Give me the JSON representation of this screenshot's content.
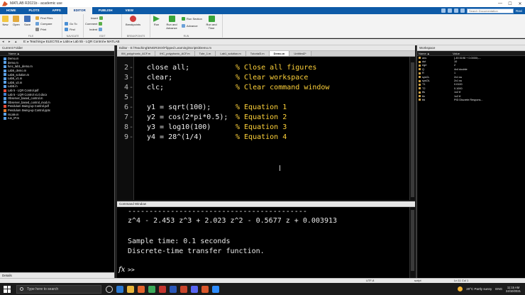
{
  "window": {
    "title": "MATLAB R2021b - academic use",
    "controls": [
      "—",
      "☐",
      "✕"
    ]
  },
  "ribbon_tabs": [
    "HOME",
    "PLOTS",
    "APPS",
    "EDITOR",
    "PUBLISH",
    "VIEW"
  ],
  "active_tab": "EDITOR",
  "search_placeholder": "Search Documentation",
  "user": "Ravi",
  "ribbon": {
    "file_group": "FILE",
    "new": "New",
    "open": "Open",
    "save": "Save",
    "find_files": "Find Files",
    "compare": "Compare",
    "print": "Print",
    "navigate_group": "NAVIGATE",
    "go_to": "Go To",
    "find": "Find",
    "edit_group": "EDIT",
    "insert": "Insert",
    "comment": "Comment",
    "indent": "Indent",
    "breakpoints_group": "BREAKPOINTS",
    "breakpoints": "Breakpoints",
    "run_group": "RUN",
    "run": "Run",
    "run_advance": "Run and Advance",
    "run_section": "Run Section",
    "advance": "Advance",
    "run_time": "Run and Time"
  },
  "address_path": "E: ▸ Teaching ▸ ELEC701 ▸ Labs ▸ Lab 5b - LQR Control ▸ MATLAB",
  "current_folder": {
    "title": "Current Folder",
    "column": "Name ▲",
    "files": [
      {
        "name": "Demo.m",
        "type": "m"
      },
      {
        "name": "demo.m",
        "type": "m"
      },
      {
        "name": "func_lab1_demo.m",
        "type": "m"
      },
      {
        "name": "Lab5_demo.m",
        "type": "m"
      },
      {
        "name": "Lab5_solution.m",
        "type": "m"
      },
      {
        "name": "Lab5_v1.m",
        "type": "m"
      },
      {
        "name": "Lab5_v2.m",
        "type": "m"
      },
      {
        "name": "Lab5.m",
        "type": "m"
      },
      {
        "name": "Lab 5 - LQR Control.pdf",
        "type": "pdf"
      },
      {
        "name": "Lab 5 - LQR Control v1.0.docx",
        "type": "doc"
      },
      {
        "name": "Observer_based_control.m",
        "type": "m"
      },
      {
        "name": "Observer_based_control_mod.m",
        "type": "m"
      },
      {
        "name": "Pendulum Swing-up Control.pdf",
        "type": "pdf"
      },
      {
        "name": "Pendulum Swing-up Control.pptx",
        "type": "ppt"
      },
      {
        "name": "rscale.m",
        "type": "m"
      },
      {
        "name": "run_IP.m",
        "type": "m"
      }
    ],
    "details": "Details"
  },
  "editor": {
    "title": "Editor - E:\\Teaching\\ENGR3XX\\Flipped Learning\\Scripts\\Demo.m",
    "tabs": [
      "IIM_polyphonic_ACF.m",
      "IHC_polyphonic_ACF.m",
      "Tute_1.m",
      "Lab1_solution.m",
      "Tutorial3.m",
      "Demo.m",
      "Untitled2*"
    ],
    "active_tab": "Demo.m",
    "lines": [
      {
        "num": "2",
        "code": "close all;",
        "comment": "% Close all figures"
      },
      {
        "num": "3",
        "code": "clear;",
        "comment": "% Clear workspace"
      },
      {
        "num": "4",
        "code": "clc;",
        "comment": "% Clear command window"
      },
      {
        "num": "5",
        "code": "",
        "comment": ""
      },
      {
        "num": "6",
        "code": "y1 = sqrt(100);",
        "comment": "% Equation 1"
      },
      {
        "num": "7",
        "code": "y2 = cos(2*pi*0.5);",
        "comment": "% Equation 2"
      },
      {
        "num": "8",
        "code": "y3 = log10(100)",
        "comment": "% Equation 3"
      },
      {
        "num": "9",
        "code": "y4 = 28^(1/4)",
        "comment": "% Equation 4"
      }
    ]
  },
  "command_window": {
    "title": "Command Window",
    "separator": "------------------------------------------",
    "equation": "z^4 - 2.453 z^3 + 2.023 z^2 - 0.5677 z + 0.003913",
    "sample_time": "Sample time: 0.1 seconds",
    "tf_label": "Discrete-time transfer function.",
    "fx": "fx",
    "prompt": ">>"
  },
  "workspace": {
    "title": "Workspace",
    "col_name": "Name ▲",
    "col_value": "Value",
    "vars": [
      {
        "name": "ans",
        "value": "[-49.5198 + 0.0000i;-..."
      },
      {
        "name": "dut",
        "value": "10"
      },
      {
        "name": "egrl",
        "value": "2"
      },
      {
        "name": "Q",
        "value": "4x4 double"
      },
      {
        "name": "R",
        "value": "1"
      },
      {
        "name": "sysCL",
        "value": "2x1 ss"
      },
      {
        "name": "sysOL",
        "value": "2x1 ss"
      },
      {
        "name": "T1",
        "value": "0.0100"
      },
      {
        "name": "T2",
        "value": "0.1000"
      },
      {
        "name": "tfs",
        "value": "1x2 tf"
      },
      {
        "name": "tfz",
        "value": "1x2 tf"
      },
      {
        "name": "tfd",
        "value": "PID Discrete Respons..."
      }
    ]
  },
  "status": {
    "encoding": "UTF-8",
    "mode": "script",
    "position": "Ln 11  Col 1"
  },
  "taskbar": {
    "search": "Type here to search",
    "weather": "20°C  Partly sunny",
    "time": "11:15 AM",
    "date": "24/10/2021",
    "lang": "ENG"
  }
}
